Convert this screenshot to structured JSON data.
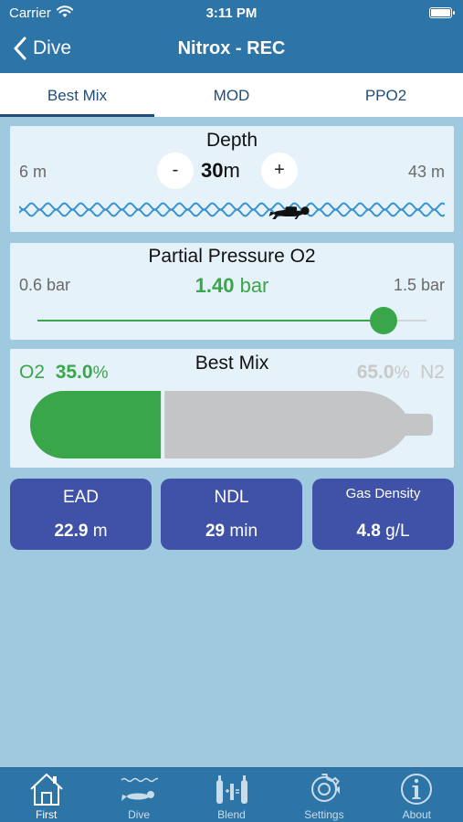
{
  "status_bar": {
    "carrier": "Carrier",
    "time": "3:11 PM"
  },
  "nav": {
    "back_label": "Dive",
    "title": "Nitrox - REC"
  },
  "tabs": [
    {
      "label": "Best Mix",
      "active": true
    },
    {
      "label": "MOD",
      "active": false
    },
    {
      "label": "PPO2",
      "active": false
    }
  ],
  "depth": {
    "title": "Depth",
    "min_label": "6 m",
    "max_label": "43 m",
    "value": "30",
    "unit": "m",
    "minus_label": "-",
    "plus_label": "+",
    "min_value": 6,
    "max_value": 43,
    "current_value": 30
  },
  "ppo2": {
    "title": "Partial Pressure O2",
    "min_label": "0.6 bar",
    "max_label": "1.5 bar",
    "value": "1.40",
    "unit": "bar",
    "min_value": 0.6,
    "max_value": 1.5,
    "current_value": 1.4
  },
  "best_mix": {
    "title": "Best Mix",
    "o2_label": "O2",
    "o2_value": "35.0",
    "o2_unit": "%",
    "n2_label": "N2",
    "n2_value": "65.0",
    "n2_unit": "%",
    "o2_fraction": 0.35
  },
  "stats": [
    {
      "label": "EAD",
      "value": "22.9",
      "unit": "m"
    },
    {
      "label": "NDL",
      "value": "29",
      "unit": "min"
    },
    {
      "label": "Gas Density",
      "value": "4.8",
      "unit": "g/L"
    }
  ],
  "tabbar": [
    {
      "label": "First",
      "icon": "house-icon",
      "active": true
    },
    {
      "label": "Dive",
      "icon": "diver-icon",
      "active": false
    },
    {
      "label": "Blend",
      "icon": "tanks-icon",
      "active": false
    },
    {
      "label": "Settings",
      "icon": "gear-icon",
      "active": false
    },
    {
      "label": "About",
      "icon": "info-icon",
      "active": false
    }
  ],
  "colors": {
    "header": "#2e75a7",
    "background": "#9ec9de",
    "card": "#e6f2f9",
    "accent_green": "#3aa64a",
    "stat_card": "#3f52a8",
    "tank_gray": "#c4c5c6",
    "wave_blue": "#3a93cf"
  }
}
